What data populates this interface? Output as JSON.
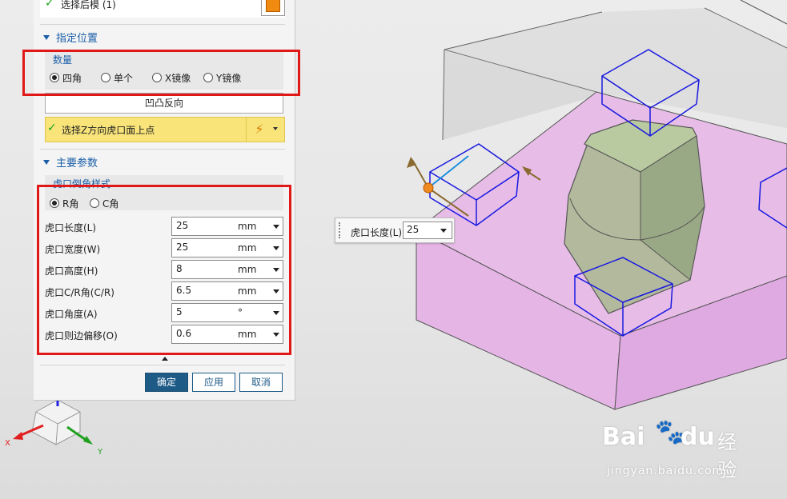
{
  "panel": {
    "top_row": "选择后模 (1)",
    "section_position": "指定位置",
    "quantity": {
      "label": "数量",
      "options": [
        "四角",
        "单个",
        "X镜像",
        "Y镜像"
      ],
      "selected": "四角"
    },
    "reverse_button": "凹凸反向",
    "select_point": "选择Z方向虎口面上点",
    "section_main": "主要参数",
    "corner_style": {
      "label": "虎口倒角样式",
      "options": [
        "R角",
        "C角"
      ],
      "selected": "R角"
    },
    "params": [
      {
        "label": "虎口长度(L)",
        "value": "25",
        "unit": "mm"
      },
      {
        "label": "虎口宽度(W)",
        "value": "25",
        "unit": "mm"
      },
      {
        "label": "虎口高度(H)",
        "value": "8",
        "unit": "mm"
      },
      {
        "label": "虎口C/R角(C/R)",
        "value": "6.5",
        "unit": "mm"
      },
      {
        "label": "虎口角度(A)",
        "value": "5",
        "unit": "°"
      },
      {
        "label": "虎口则边偏移(O)",
        "value": "0.6",
        "unit": "mm"
      }
    ],
    "buttons": {
      "ok": "确定",
      "apply": "应用",
      "cancel": "取消"
    }
  },
  "tooltip": {
    "label": "虎口长度(L)",
    "value": "25"
  },
  "axes": {
    "x": "X",
    "y": "Y"
  },
  "watermark": {
    "brand_a": "Bai",
    "brand_b": "du",
    "product": "经验",
    "url": "jingyan.baidu.com"
  },
  "colors": {
    "accent_blue": "#1b5ea8",
    "highlight_yellow": "#f9e47a",
    "annotation_red": "#e01818",
    "primary_button": "#1d5a86",
    "face_pink": "#e0b2e2",
    "wire_blue": "#1818e0"
  }
}
